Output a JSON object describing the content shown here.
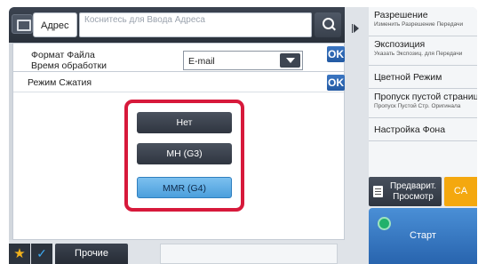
{
  "address_bar": {
    "button_label": "Адрес",
    "input_placeholder": "Коснитесь для Ввода Адреса"
  },
  "settings": {
    "file_format_label": "Формат Файла",
    "processing_time_label": "Время обработки",
    "format_value": "E-mail",
    "ok_label": "OK"
  },
  "compression": {
    "title": "Режим Сжатия",
    "ok_label": "OK",
    "options": [
      "Нет",
      "MH (G3)",
      "MMR (G4)"
    ],
    "selected": "MMR (G4)"
  },
  "bottom_bar": {
    "other_label": "Прочие"
  },
  "right_menu": {
    "items": [
      {
        "title": "Разрешение",
        "subtitle": "Изменить Разрешение Передачи"
      },
      {
        "title": "Экспозиция",
        "subtitle": "Указать Экспозиц. для Передачи"
      },
      {
        "title": "Цветной Режим",
        "subtitle": ""
      },
      {
        "title": "Пропуск пустой страницы",
        "subtitle": "Пропуск Пустой Стр. Оригинала"
      },
      {
        "title": "Настройка Фона",
        "subtitle": ""
      }
    ],
    "preview_label": "Предварит. Просмотр",
    "ca_label": "CA",
    "start_label": "Старт"
  },
  "colors": {
    "highlight_border": "#d7193b",
    "selected_option": "#5aa9e3",
    "ca_button": "#f4a80f",
    "start_button": "#2f6fba"
  }
}
